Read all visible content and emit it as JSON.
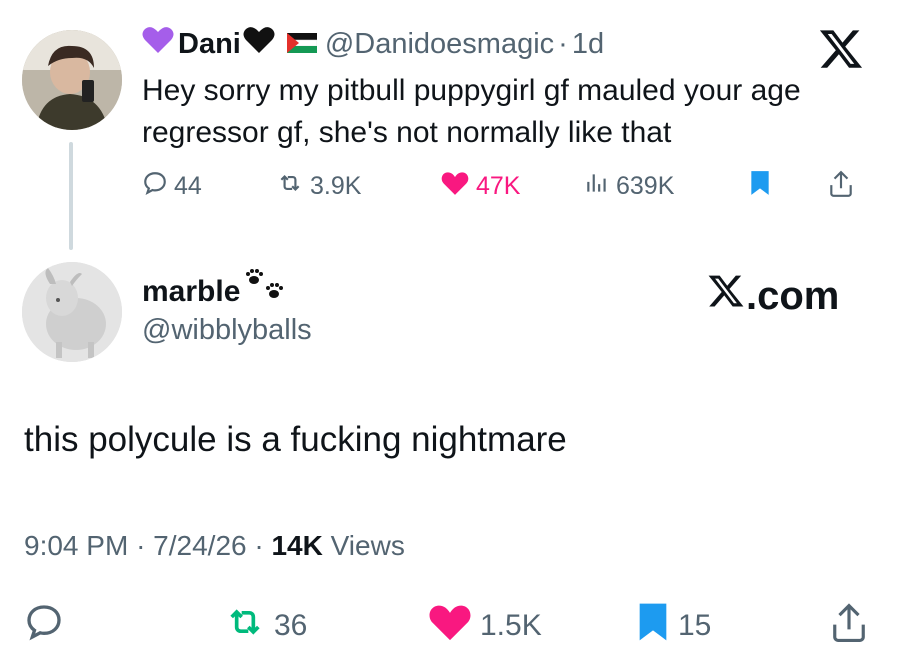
{
  "quoted_tweet": {
    "name": "Dani",
    "handle": "@Danidoesmagic",
    "separator": "·",
    "time": "1d",
    "text": "Hey sorry my pitbull puppygirl gf mauled your age regressor gf, she's not normally like that",
    "replies": "44",
    "reposts": "3.9K",
    "likes": "47K",
    "views": "639K",
    "name_emoji_left": "purple-heart-icon",
    "name_emoji_right": "black-heart-icon",
    "flag_icon": "palestine-flag-icon"
  },
  "main_tweet": {
    "name": "marble",
    "name_emoji": "paw-prints-icon",
    "handle": "@wibblyballs",
    "text": "this polycule is a fucking nightmare",
    "time": "9:04 PM",
    "date": "7/24/26",
    "views_count": "14K",
    "views_label": "Views",
    "dot": "·",
    "reposts": "36",
    "likes": "1.5K",
    "bookmarks": "15"
  },
  "watermark": {
    "domain": ".com"
  },
  "colors": {
    "like": "#f91880",
    "bookmark": "#1d9bf0",
    "secondary_text": "#536471",
    "primary_text": "#0f1419"
  }
}
